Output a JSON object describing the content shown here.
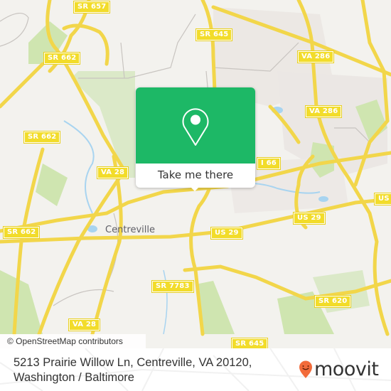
{
  "map": {
    "place_label": "Centreville",
    "road_shields": [
      {
        "id": "sr657",
        "text": "SR 657"
      },
      {
        "id": "sr662a",
        "text": "SR 662"
      },
      {
        "id": "sr662b",
        "text": "SR 662"
      },
      {
        "id": "sr662c",
        "text": "SR 662"
      },
      {
        "id": "sr645a",
        "text": "SR 645"
      },
      {
        "id": "va286a",
        "text": "VA 286"
      },
      {
        "id": "va286b",
        "text": "VA 286"
      },
      {
        "id": "va28a",
        "text": "VA 28"
      },
      {
        "id": "va28b",
        "text": "VA 28"
      },
      {
        "id": "i66",
        "text": "I 66"
      },
      {
        "id": "us29a",
        "text": "US 29"
      },
      {
        "id": "us29b",
        "text": "US 29"
      },
      {
        "id": "us29c",
        "text": "US"
      },
      {
        "id": "sr7783",
        "text": "SR 7783"
      },
      {
        "id": "sr620",
        "text": "SR 620"
      },
      {
        "id": "sr645b",
        "text": "SR 645"
      }
    ],
    "attribution": "© OpenStreetMap contributors",
    "colors": {
      "land": "#f3f2ee",
      "park": "#cfe5b0",
      "water": "#a8d4f0",
      "road": "#f7df5a",
      "minor_road": "#c8c4c0"
    }
  },
  "popup": {
    "icon": "map-pin-icon",
    "cta_label": "Take me there",
    "accent": "#1db866"
  },
  "footer": {
    "address_line1": "5213 Prairie Willow Ln, Centreville, VA 20120,",
    "address_line2": "Washington / Baltimore",
    "brand": "moovit",
    "brand_color": "#f26b3a"
  }
}
